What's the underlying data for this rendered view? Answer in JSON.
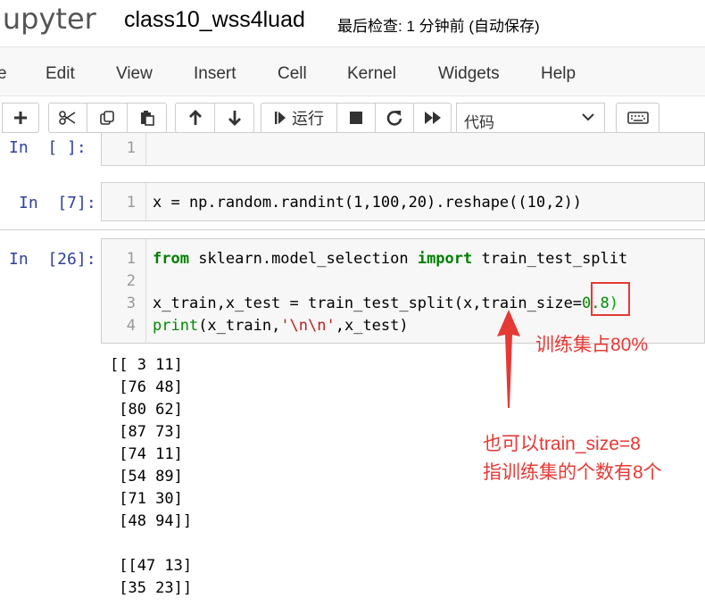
{
  "header": {
    "logo": "jupyter",
    "notebook_name": "class10_wss4luad",
    "checkpoint_text": "最后检查: 1 分钟前  (自动保存)"
  },
  "menu": {
    "items": [
      "e",
      "Edit",
      "View",
      "Insert",
      "Cell",
      "Kernel",
      "Widgets",
      "Help"
    ]
  },
  "toolbar": {
    "run_label": "运行",
    "cell_type": "代码"
  },
  "cells": [
    {
      "prompt": "In  [ ]:",
      "lines": [
        "1"
      ]
    },
    {
      "prompt": "In  [7]:",
      "lines": [
        "1"
      ],
      "code": [
        "x = np.random.randint(1,100,20).reshape((10,2))"
      ]
    },
    {
      "prompt": "In  [26]:",
      "lines": [
        "1",
        "2",
        "3",
        "4"
      ],
      "code_line1_kw1": "from",
      "code_line1_mid": " sklearn.model_selection ",
      "code_line1_kw2": "import",
      "code_line1_end": " train_test_split",
      "code_line3_pre": "x_train,x_test = train_test_split(x,train_size=",
      "code_line3_num": "0.8",
      "code_line3_end": ")",
      "code_line4_fn": "print",
      "code_line4_pre": "(x_train,",
      "code_line4_str": "'\\n\\n'",
      "code_line4_end": ",x_test)"
    }
  ],
  "output": [
    "[[ 3 11]",
    " [76 48]",
    " [80 62]",
    " [87 73]",
    " [74 11]",
    " [54 89]",
    " [71 30]",
    " [48 94]]",
    "",
    " [[47 13]",
    " [35 23]]"
  ],
  "annotations": {
    "note1": "训练集占80%",
    "note2_line1": "也可以train_size=8",
    "note2_line2": "指训练集的个数有8个",
    "color": "#e53935"
  }
}
